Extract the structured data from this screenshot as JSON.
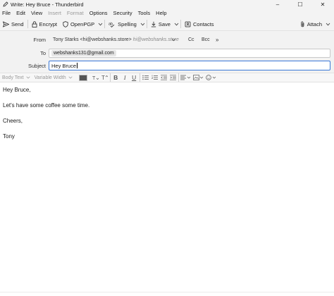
{
  "window": {
    "title": "Write: Hey Bruce - Thunderbird",
    "controls": {
      "minimize": "–",
      "maximize": "☐",
      "close": "✕"
    }
  },
  "menubar": {
    "items": [
      {
        "label": "File",
        "enabled": true
      },
      {
        "label": "Edit",
        "enabled": true
      },
      {
        "label": "View",
        "enabled": true
      },
      {
        "label": "Insert",
        "enabled": false
      },
      {
        "label": "Format",
        "enabled": false
      },
      {
        "label": "Options",
        "enabled": true
      },
      {
        "label": "Security",
        "enabled": true
      },
      {
        "label": "Tools",
        "enabled": true
      },
      {
        "label": "Help",
        "enabled": true
      }
    ]
  },
  "toolbar": {
    "send": "Send",
    "encrypt": "Encrypt",
    "openpgp": "OpenPGP",
    "spelling": "Spelling",
    "save": "Save",
    "contacts": "Contacts",
    "attach": "Attach"
  },
  "headers": {
    "from_label": "From",
    "from_name": "Tony Starks <hi@webshanks.store>",
    "from_identity": "hi@webshanks.store",
    "cc_label": "Cc",
    "bcc_label": "Bcc",
    "more_label": "»",
    "to_label": "To",
    "to_recipient": "webshanks131@gmail.com",
    "subject_label": "Subject",
    "subject_value": "Hey Bruce"
  },
  "format_toolbar": {
    "paragraph_style": "Body Text",
    "font": "Variable Width",
    "colors": {
      "text_color": "#555555",
      "focus": "#3a78d8"
    }
  },
  "message": {
    "paragraphs": [
      "Hey Bruce,",
      "Let's have some coffee some time.",
      "Cheers,",
      "Tony"
    ]
  }
}
